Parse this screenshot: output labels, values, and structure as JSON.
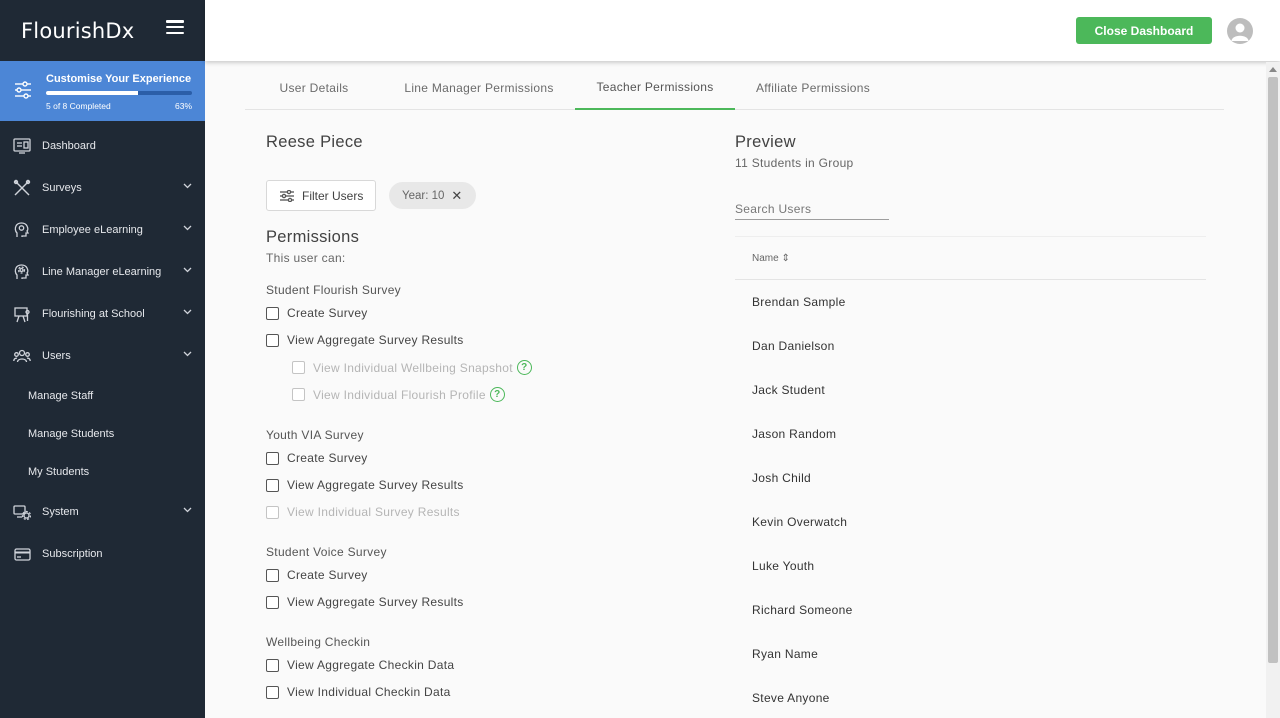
{
  "brand": {
    "name_main": "Flourish",
    "name_suffix": "Dx"
  },
  "customise": {
    "title": "Customise Your Experience",
    "status": "5 of 8 Completed",
    "percent": "63%",
    "progress": 0.63
  },
  "nav": {
    "dashboard": "Dashboard",
    "surveys": "Surveys",
    "employee_elearning": "Employee eLearning",
    "line_manager_elearning": "Line Manager eLearning",
    "flourishing_at_school": "Flourishing at School",
    "users": "Users",
    "users_sub": [
      "Manage Staff",
      "Manage Students",
      "My Students"
    ],
    "system": "System",
    "subscription": "Subscription"
  },
  "header": {
    "close_label": "Close Dashboard"
  },
  "tabs": [
    "User Details",
    "Line Manager Permissions",
    "Teacher Permissions",
    "Affiliate Permissions"
  ],
  "active_tab": "Teacher Permissions",
  "user": {
    "name": "Reese Piece"
  },
  "filter": {
    "button_label": "Filter Users",
    "chip_label": "Year: 10",
    "chip_close": "✕"
  },
  "permissions": {
    "title": "Permissions",
    "subtitle": "This user can:",
    "groups": [
      {
        "title": "Student Flourish Survey",
        "items": [
          "Create Survey",
          "View Aggregate Survey Results",
          "View Individual Wellbeing Snapshot",
          "View Individual Flourish Profile"
        ]
      },
      {
        "title": "Youth VIA Survey",
        "items": [
          "Create Survey",
          "View Aggregate Survey Results",
          "View Individual Survey Results"
        ]
      },
      {
        "title": "Student Voice Survey",
        "items": [
          "Create Survey",
          "View Aggregate Survey Results"
        ]
      },
      {
        "title": "Wellbeing Checkin",
        "items": [
          "View Aggregate Checkin Data",
          "View Individual Checkin Data"
        ]
      }
    ]
  },
  "help_glyph": "?",
  "preview": {
    "title": "Preview",
    "subtitle": "11 Students in Group",
    "search_placeholder": "Search Users",
    "column_name": "Name ⇕",
    "students": [
      "Brendan Sample",
      "Dan Danielson",
      "Jack Student",
      "Jason Random",
      "Josh Child",
      "Kevin Overwatch",
      "Luke Youth",
      "Richard Someone",
      "Ryan Name",
      "Steve Anyone"
    ]
  },
  "colors": {
    "accent_green": "#4cb85a",
    "sidebar_bg": "#1f2935",
    "customise_blue": "#4c86d6"
  }
}
